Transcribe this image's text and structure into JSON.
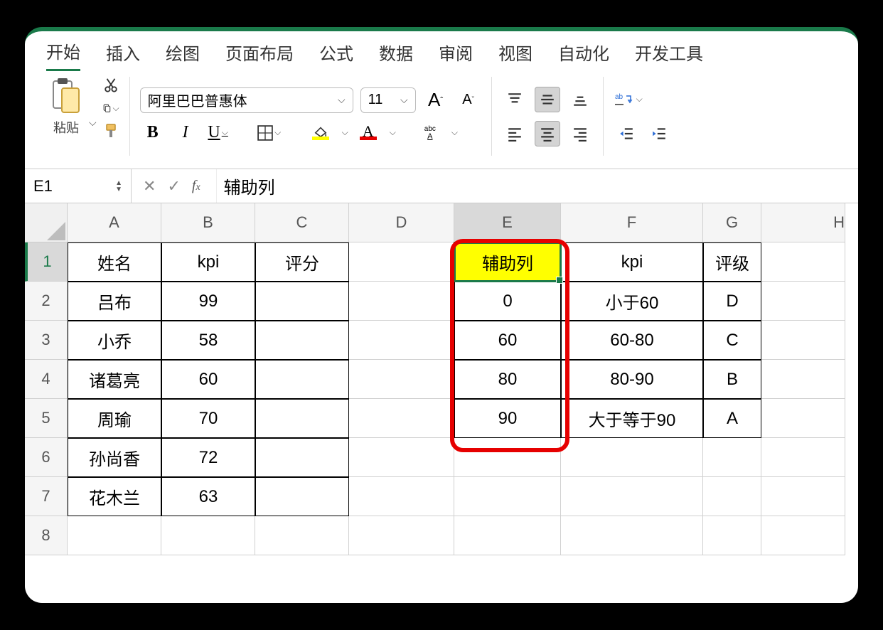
{
  "tabs": {
    "home": "开始",
    "insert": "插入",
    "draw": "绘图",
    "layout": "页面布局",
    "formulas": "公式",
    "data": "数据",
    "review": "审阅",
    "view": "视图",
    "automate": "自动化",
    "developer": "开发工具"
  },
  "ribbon": {
    "paste_label": "粘贴",
    "font_name": "阿里巴巴普惠体",
    "font_size": "11",
    "bold": "B",
    "italic": "I",
    "underline": "U",
    "font_grow": "A",
    "font_shrink": "A",
    "fill_color": "#ffff00",
    "font_color": "#e60000",
    "phonetic": "abc",
    "wrap_text": "ab"
  },
  "namebox": {
    "ref": "E1",
    "formula": "辅助列"
  },
  "columns": [
    "A",
    "B",
    "C",
    "D",
    "E",
    "F",
    "G"
  ],
  "rows": [
    "1",
    "2",
    "3",
    "4",
    "5",
    "6",
    "7",
    "8"
  ],
  "table1": {
    "headers": {
      "a": "姓名",
      "b": "kpi",
      "c": "评分"
    },
    "rows": [
      {
        "a": "吕布",
        "b": "99",
        "c": ""
      },
      {
        "a": "小乔",
        "b": "58",
        "c": ""
      },
      {
        "a": "诸葛亮",
        "b": "60",
        "c": ""
      },
      {
        "a": "周瑜",
        "b": "70",
        "c": ""
      },
      {
        "a": "孙尚香",
        "b": "72",
        "c": ""
      },
      {
        "a": "花木兰",
        "b": "63",
        "c": ""
      }
    ]
  },
  "table2": {
    "headers": {
      "e": "辅助列",
      "f": "kpi",
      "g": "评级"
    },
    "rows": [
      {
        "e": "0",
        "f": "小于60",
        "g": "D"
      },
      {
        "e": "60",
        "f": "60-80",
        "g": "C"
      },
      {
        "e": "80",
        "f": "80-90",
        "g": "B"
      },
      {
        "e": "90",
        "f": "大于等于90",
        "g": "A"
      }
    ]
  }
}
